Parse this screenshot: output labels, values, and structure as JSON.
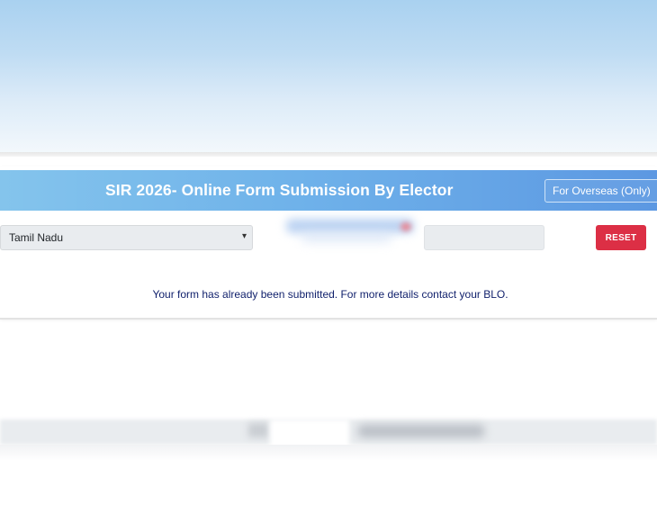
{
  "banner": {
    "title": "SIR 2026- Online Form Submission By Elector",
    "overseas_label": "For Overseas (Only)",
    "overseas_icon": "external-link-arrow-icon"
  },
  "form": {
    "state_selected": "Tamil Nadu",
    "reset_label": "RESET"
  },
  "status": {
    "message": "Your form has already been submitted. For more details contact your BLO."
  },
  "colors": {
    "banner_start": "#84c4ec",
    "banner_end": "#5c98e2",
    "reset_button": "#dc2f45",
    "message_text": "#0f1f6b"
  }
}
